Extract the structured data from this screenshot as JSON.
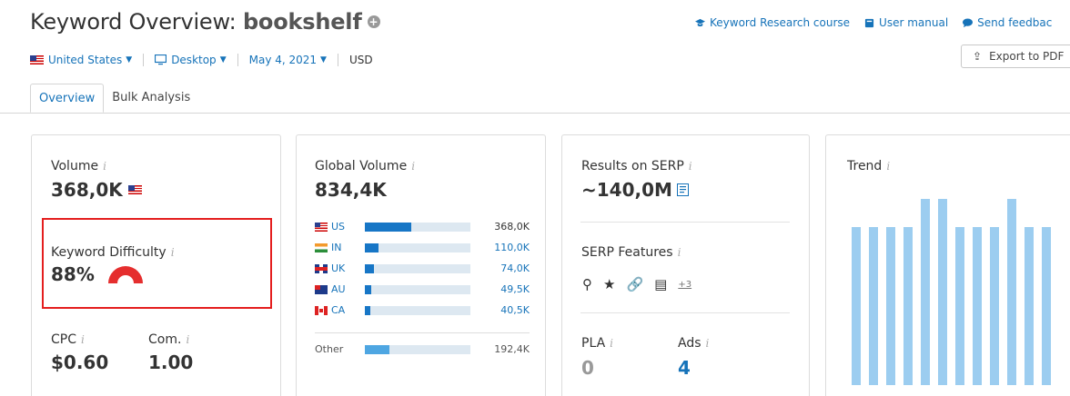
{
  "header": {
    "title_prefix": "Keyword Overview:",
    "keyword": "bookshelf",
    "links": [
      {
        "label": "Keyword Research course",
        "icon": "graduation-cap-icon"
      },
      {
        "label": "User manual",
        "icon": "book-icon"
      },
      {
        "label": "Send feedbac",
        "icon": "chat-bubble-icon"
      }
    ],
    "export_label": "Export to PDF"
  },
  "filters": {
    "country": "United States",
    "device": "Desktop",
    "date": "May 4, 2021",
    "currency": "USD"
  },
  "tabs": [
    {
      "label": "Overview",
      "active": true
    },
    {
      "label": "Bulk Analysis",
      "active": false
    }
  ],
  "volume_card": {
    "label": "Volume",
    "info": "i",
    "value": "368,0K",
    "kd_label": "Keyword Difficulty",
    "kd_value": "88%",
    "kd_color": "#e52e2e",
    "cpc_label": "CPC",
    "cpc_value": "$0.60",
    "com_label": "Com.",
    "com_value": "1.00"
  },
  "global_volume_card": {
    "label": "Global Volume",
    "value": "834,4K",
    "rows": [
      {
        "code": "US",
        "value": "368,0K",
        "fraction": 0.44
      },
      {
        "code": "IN",
        "value": "110,0K",
        "fraction": 0.13
      },
      {
        "code": "UK",
        "value": "74,0K",
        "fraction": 0.09
      },
      {
        "code": "AU",
        "value": "49,5K",
        "fraction": 0.06
      },
      {
        "code": "CA",
        "value": "40,5K",
        "fraction": 0.05
      }
    ],
    "other": {
      "code": "Other",
      "value": "192,4K",
      "fraction": 0.23
    }
  },
  "serp_card": {
    "label": "Results on SERP",
    "value": "~140,0M",
    "features_label": "SERP Features",
    "features_more": "+3",
    "pla_label": "PLA",
    "pla_value": "0",
    "ads_label": "Ads",
    "ads_value": "4"
  },
  "trend_card": {
    "label": "Trend",
    "values": [
      0.85,
      0.85,
      0.85,
      0.85,
      1.0,
      1.0,
      0.85,
      0.85,
      0.85,
      1.0,
      0.85,
      0.85
    ]
  }
}
